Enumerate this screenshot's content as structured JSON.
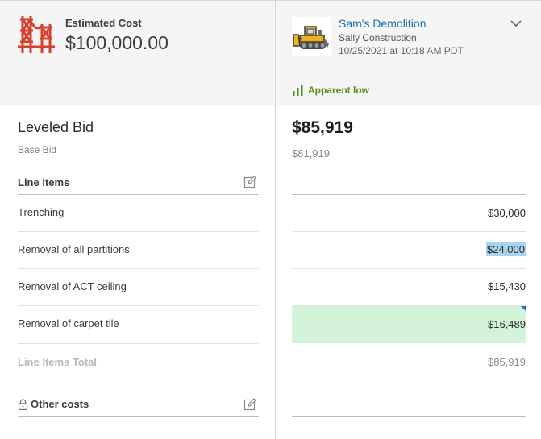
{
  "estimate": {
    "label": "Estimated Cost",
    "value": "$100,000.00",
    "icon": "bridge-icon",
    "icon_color": "#d8402b"
  },
  "bid": {
    "bidder_name": "Sam's Demolition",
    "company": "Sally Construction",
    "date": "10/25/2021 at 10:18 AM PDT",
    "icon": "bulldozer-icon",
    "status": "Apparent low",
    "status_color": "#5a8d20",
    "total": "$85,919",
    "base_bid": "$81,919"
  },
  "left": {
    "title": "Leveled Bid",
    "base_bid_label": "Base Bid",
    "line_items_label": "Line items",
    "line_items_total_label": "Line Items Total",
    "other_costs_label": "Other costs"
  },
  "line_items": [
    {
      "label": "Trenching",
      "value": "$30,000"
    },
    {
      "label": "Removal of all partitions",
      "value": "$24,000"
    },
    {
      "label": "Removal of ACT ceiling",
      "value": "$15,430"
    },
    {
      "label": "Removal of carpet tile",
      "value": "$16,489"
    }
  ],
  "line_items_total": "$85,919",
  "colors": {
    "link": "#1a6fb0",
    "selection_highlight": "#a9d4f1",
    "edited_cell": "#d3f4d8",
    "cell_marker": "#1a78c2"
  }
}
